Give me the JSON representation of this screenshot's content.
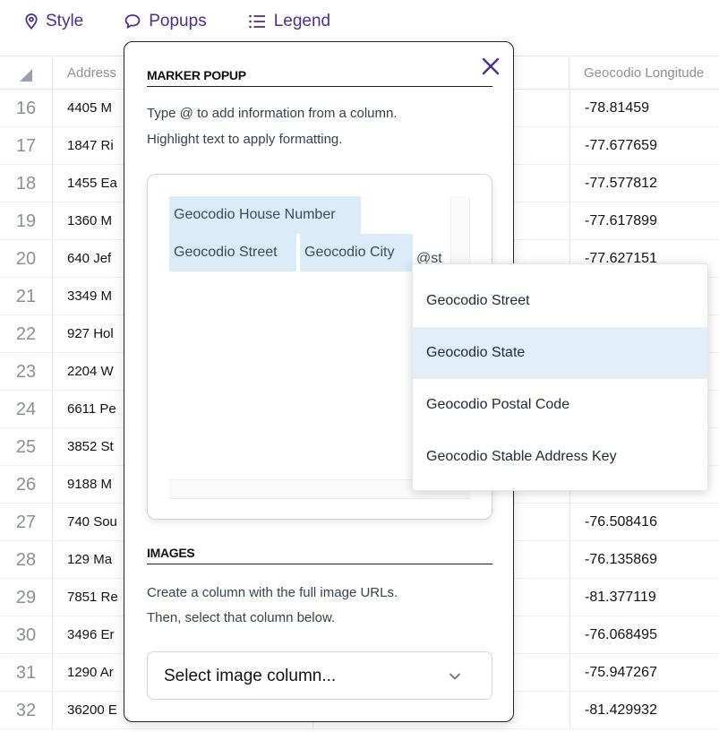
{
  "toolbar": {
    "style_label": "Style",
    "popups_label": "Popups",
    "legend_label": "Legend",
    "accent": "#4c2f8f"
  },
  "grid": {
    "col_address": "Address",
    "col_longitude": "Geocodio Longitude",
    "rows": [
      {
        "n": "16",
        "address": "4405 M",
        "lon": "-78.81459"
      },
      {
        "n": "17",
        "address": "1847 Ri",
        "lon": "-77.677659"
      },
      {
        "n": "18",
        "address": "1455 Ea",
        "lon": "-77.577812"
      },
      {
        "n": "19",
        "address": "1360 M",
        "lon": "-77.617899"
      },
      {
        "n": "20",
        "address": "640 Jef",
        "lon": "-77.627151"
      },
      {
        "n": "21",
        "address": "3349 M",
        "lon": ""
      },
      {
        "n": "22",
        "address": "927 Hol",
        "lon": ""
      },
      {
        "n": "23",
        "address": "2204 W",
        "lon": ""
      },
      {
        "n": "24",
        "address": "6611 Pe",
        "lon": ""
      },
      {
        "n": "25",
        "address": "3852 St",
        "lon": ""
      },
      {
        "n": "26",
        "address": "9188 M",
        "lon": ""
      },
      {
        "n": "27",
        "address": "740 Sou",
        "lon": "-76.508416"
      },
      {
        "n": "28",
        "address": "129 Ma",
        "lon": "-76.135869"
      },
      {
        "n": "29",
        "address": "7851 Re",
        "lon": "-81.377119"
      },
      {
        "n": "30",
        "address": "3496 Er",
        "lon": "-76.068495"
      },
      {
        "n": "31",
        "address": "1290 Ar",
        "lon": "-75.947267"
      },
      {
        "n": "32",
        "address": "36200 E",
        "lon": "-81.429932"
      }
    ]
  },
  "popup_panel": {
    "marker_title": "MARKER POPUP",
    "help_line1": "Type @ to add information from a column.",
    "help_line2": "Highlight text to apply formatting.",
    "editor": {
      "chip_house_number": "Geocodio House Number",
      "chip_street": "Geocodio Street",
      "chip_city": "Geocodio City",
      "typed_text": "@st"
    },
    "images_title": "IMAGES",
    "images_help1": "Create a column with the full image URLs.",
    "images_help2": "Then, select that column below.",
    "image_select_placeholder": "Select image column..."
  },
  "autocomplete": {
    "items": [
      {
        "label": "Geocodio Street",
        "active": false
      },
      {
        "label": "Geocodio State",
        "active": true
      },
      {
        "label": "Geocodio Postal Code",
        "active": false
      },
      {
        "label": "Geocodio Stable Address Key",
        "active": false
      }
    ]
  }
}
